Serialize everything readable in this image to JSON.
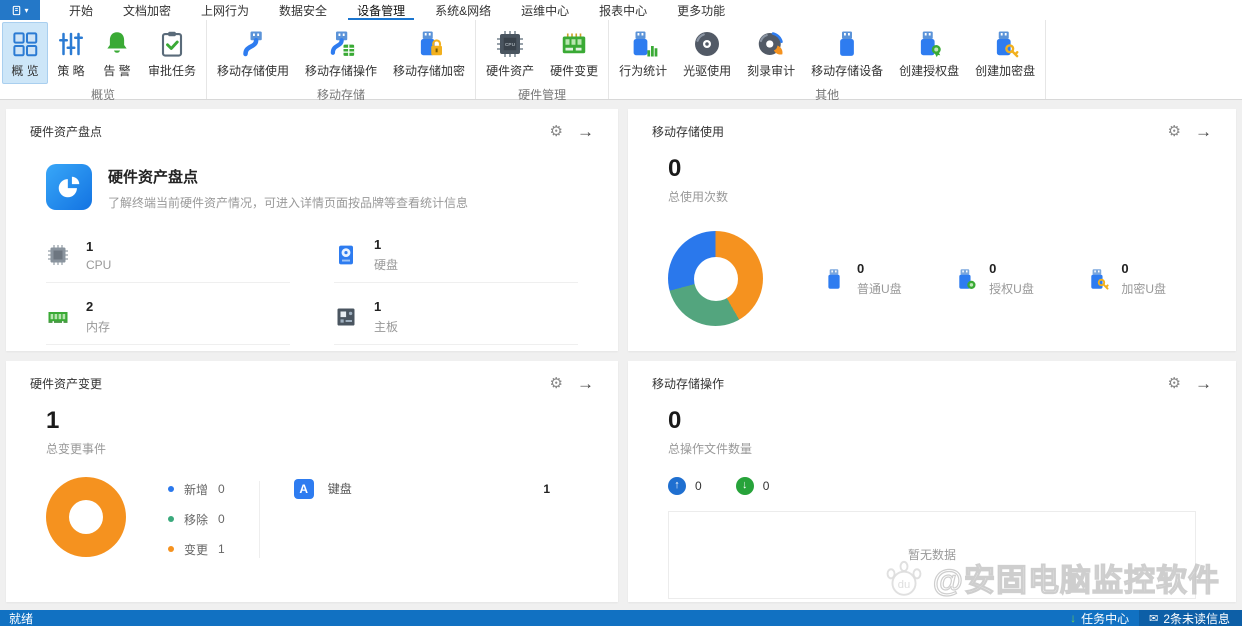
{
  "menu": {
    "app_caret": "▾",
    "items": [
      {
        "label": "开始"
      },
      {
        "label": "文档加密"
      },
      {
        "label": "上网行为"
      },
      {
        "label": "数据安全"
      },
      {
        "label": "设备管理"
      },
      {
        "label": "系统&网络"
      },
      {
        "label": "运维中心"
      },
      {
        "label": "报表中心"
      },
      {
        "label": "更多功能"
      }
    ],
    "active_item": "设备管理"
  },
  "ribbon": {
    "groups": [
      {
        "label": "概览",
        "items": [
          {
            "label": "概 览"
          },
          {
            "label": "策 略"
          },
          {
            "label": "告 警"
          },
          {
            "label": "审批任务"
          }
        ]
      },
      {
        "label": "移动存储",
        "items": [
          {
            "label": "移动存储使用"
          },
          {
            "label": "移动存储操作"
          },
          {
            "label": "移动存储加密"
          }
        ]
      },
      {
        "label": "硬件管理",
        "items": [
          {
            "label": "硬件资产"
          },
          {
            "label": "硬件变更"
          }
        ]
      },
      {
        "label": "其他",
        "items": [
          {
            "label": "行为统计"
          },
          {
            "label": "光驱使用"
          },
          {
            "label": "刻录审计"
          },
          {
            "label": "移动存储设备"
          },
          {
            "label": "创建授权盘"
          },
          {
            "label": "创建加密盘"
          }
        ]
      }
    ],
    "selected_item": "概 览"
  },
  "panels": {
    "hardware_inventory": {
      "title": "硬件资产盘点",
      "card_title": "硬件资产盘点",
      "card_desc": "了解终端当前硬件资产情况，可进入详情页面按品牌等查看统计信息",
      "stats": [
        {
          "value": "1",
          "label": "CPU"
        },
        {
          "value": "1",
          "label": "硬盘"
        },
        {
          "value": "2",
          "label": "内存"
        },
        {
          "value": "1",
          "label": "主板"
        }
      ]
    },
    "usb_usage": {
      "title": "移动存储使用",
      "total_value": "0",
      "total_label": "总使用次数",
      "donut": [
        {
          "color": "#f5921f",
          "pct": 41.7
        },
        {
          "color": "#53a57e",
          "pct": 29.15
        },
        {
          "color": "#2a78ec",
          "pct": 29.15
        }
      ],
      "legend": [
        {
          "value": "0",
          "label": "普通U盘"
        },
        {
          "value": "0",
          "label": "授权U盘"
        },
        {
          "value": "0",
          "label": "加密U盘"
        }
      ]
    },
    "hardware_change": {
      "title": "硬件资产变更",
      "total_value": "1",
      "total_label": "总变更事件",
      "donut": [
        {
          "color": "#f5921f",
          "pct": 100
        }
      ],
      "legend": [
        {
          "label": "新增",
          "value": "0",
          "color": "#2a78ec"
        },
        {
          "label": "移除",
          "value": "0",
          "color": "#3aa97c"
        },
        {
          "label": "变更",
          "value": "1",
          "color": "#f5921f"
        }
      ],
      "detail": {
        "badge": "A",
        "label": "键盘",
        "value": "1"
      }
    },
    "usb_operation": {
      "title": "移动存储操作",
      "total_value": "0",
      "total_label": "总操作文件数量",
      "upload_count": "0",
      "download_count": "0",
      "empty_text": "暂无数据"
    }
  },
  "chart_data": [
    {
      "type": "pie",
      "title": "移动存储使用",
      "series": [
        {
          "name": "普通U盘",
          "value": 0
        },
        {
          "name": "授权U盘",
          "value": 0
        },
        {
          "name": "加密U盘",
          "value": 0
        }
      ],
      "display_segments_pct": [
        41.7,
        29.15,
        29.15
      ],
      "colors": [
        "#f5921f",
        "#53a57e",
        "#2a78ec"
      ],
      "note": "placeholder donut, all counts are 0; total 0"
    },
    {
      "type": "pie",
      "title": "硬件资产变更",
      "series": [
        {
          "name": "新增",
          "value": 0
        },
        {
          "name": "移除",
          "value": 0
        },
        {
          "name": "变更",
          "value": 1
        }
      ],
      "colors": [
        "#2a78ec",
        "#3aa97c",
        "#f5921f"
      ],
      "note": "donut fully orange (变更=1 of total 1); 键盘 count 1"
    }
  ],
  "icons": {
    "gear": "⚙",
    "arrow_right": "→",
    "up_arrow": "↑",
    "down_arrow": "↓",
    "envelope": "✉",
    "task_down": "↓",
    "paw_text": "du"
  },
  "status_bar": {
    "ready": "就绪",
    "task_center": "任务中心",
    "unread": "2条未读信息"
  },
  "watermark": {
    "text": "@安固电脑监控软件"
  }
}
